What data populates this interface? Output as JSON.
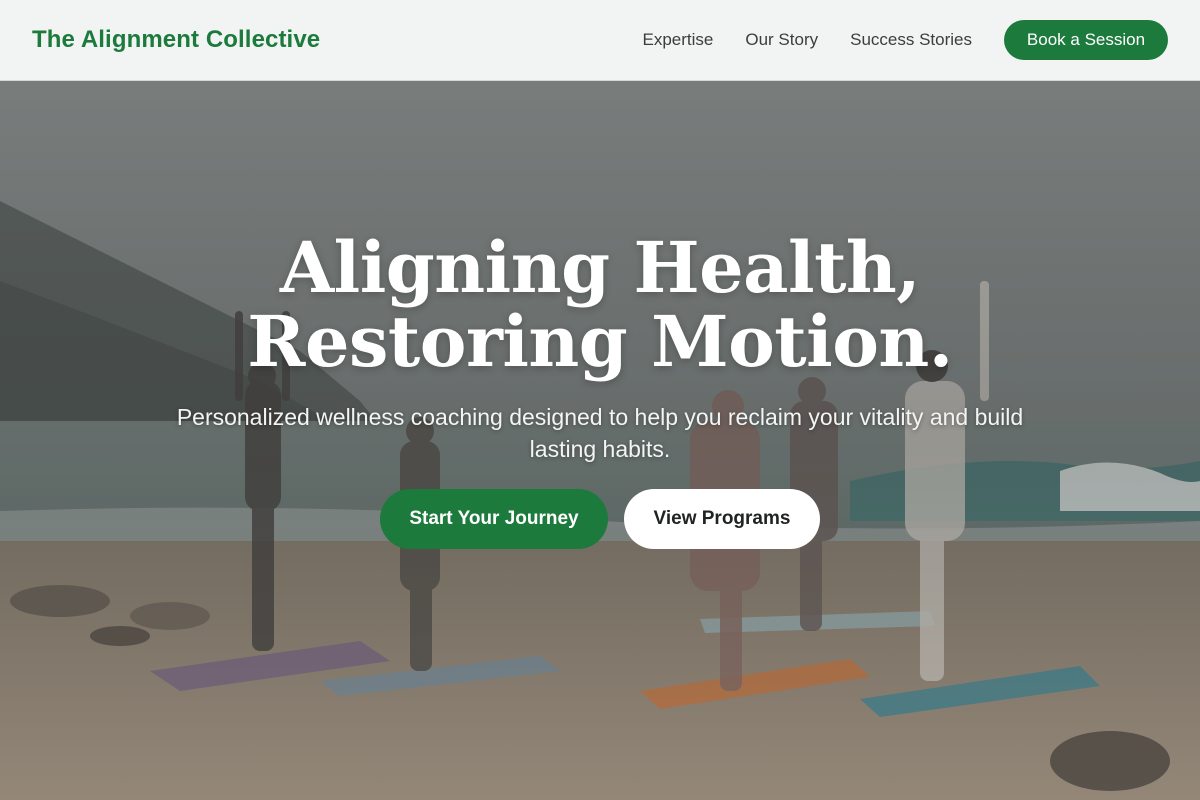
{
  "header": {
    "brand": "The Alignment Collective",
    "nav": [
      {
        "label": "Expertise"
      },
      {
        "label": "Our Story"
      },
      {
        "label": "Success Stories"
      }
    ],
    "cta_label": "Book a Session"
  },
  "hero": {
    "title_line1": "Aligning Health,",
    "title_line2": "Restoring Motion.",
    "subtitle": "Personalized wellness coaching designed to help you reclaim your vitality and build lasting habits.",
    "primary_cta": "Start Your Journey",
    "secondary_cta": "View Programs",
    "background_image": "beach-yoga-group-photo"
  },
  "colors": {
    "brand_green": "#1c7a3c",
    "header_bg": "#f2f3f3",
    "nav_text": "#3a3f3d",
    "white": "#ffffff"
  }
}
